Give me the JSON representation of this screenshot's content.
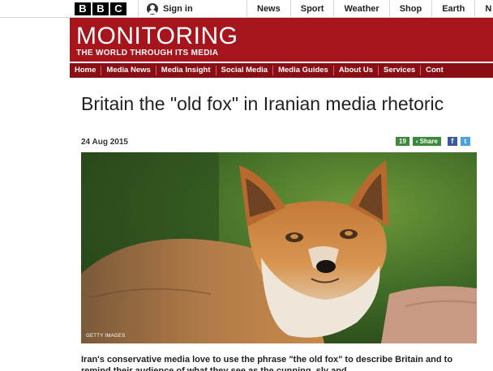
{
  "brand": {
    "letters": [
      "B",
      "B",
      "C"
    ]
  },
  "signin": {
    "label": "Sign in"
  },
  "topnav": [
    "News",
    "Sport",
    "Weather",
    "Shop",
    "Earth",
    "N"
  ],
  "masthead": {
    "title": "MONITORING",
    "tagline": "THE WORLD THROUGH ITS MEDIA",
    "color": "#a6141c"
  },
  "sectionnav": [
    "Home",
    "Media News",
    "Media Insight",
    "Social Media",
    "Media Guides",
    "About Us",
    "Services",
    "Cont"
  ],
  "article": {
    "headline": "Britain the \"old fox\" in Iranian media rhetoric",
    "date": "24 Aug 2015",
    "share_count": "19",
    "share_label": "Share",
    "photo_credit": "GETTY IMAGES",
    "lede": "Iran's conservative media love to use the phrase \"the old fox\" to describe Britain and to remind their audience of what they see as the cunning, sly and"
  },
  "icons": {
    "signin": "user-icon",
    "share": "share-icon",
    "facebook": "facebook-icon",
    "twitter": "twitter-icon"
  }
}
